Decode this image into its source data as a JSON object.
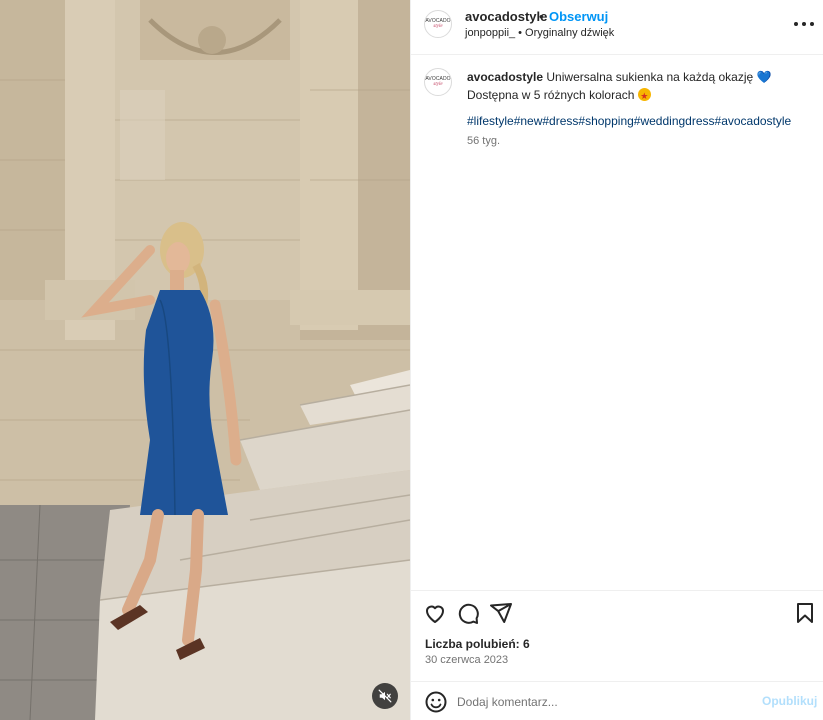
{
  "post": {
    "username": "avocadostyle",
    "separator": "•",
    "follow_label": "Obserwuj",
    "audio_user": "jonpoppii_",
    "audio_sep": "•",
    "audio_label": "Oryginalny dźwięk",
    "avatar_logo_top": "AVOCADO",
    "avatar_logo_bottom": "style"
  },
  "caption": {
    "username": "avocadostyle",
    "line1": "Uniwersalna sukienka na każdą okazję",
    "line1_emoji": "💙",
    "line2": "Dostępna w 5 różnych kolorach",
    "hashtags": [
      "#lifestyle",
      "#new",
      "#dress",
      "#shopping",
      "#weddingdress",
      "#avocadostyle"
    ],
    "time": "56 tyg."
  },
  "actions": {
    "icons": [
      "heart-icon",
      "comment-icon",
      "share-icon",
      "bookmark-icon"
    ],
    "likes": "Liczba polubień: 6",
    "date": "30 czerwca 2023"
  },
  "comment": {
    "placeholder": "Dodaj komentarz...",
    "publish_label": "Opublikuj"
  },
  "media": {
    "mute_icon": "muted-speaker-icon"
  },
  "colors": {
    "accent": "#0095f6",
    "link": "#00376b",
    "publish_disabled": "#b2dffc",
    "dress": "#1f5499"
  }
}
